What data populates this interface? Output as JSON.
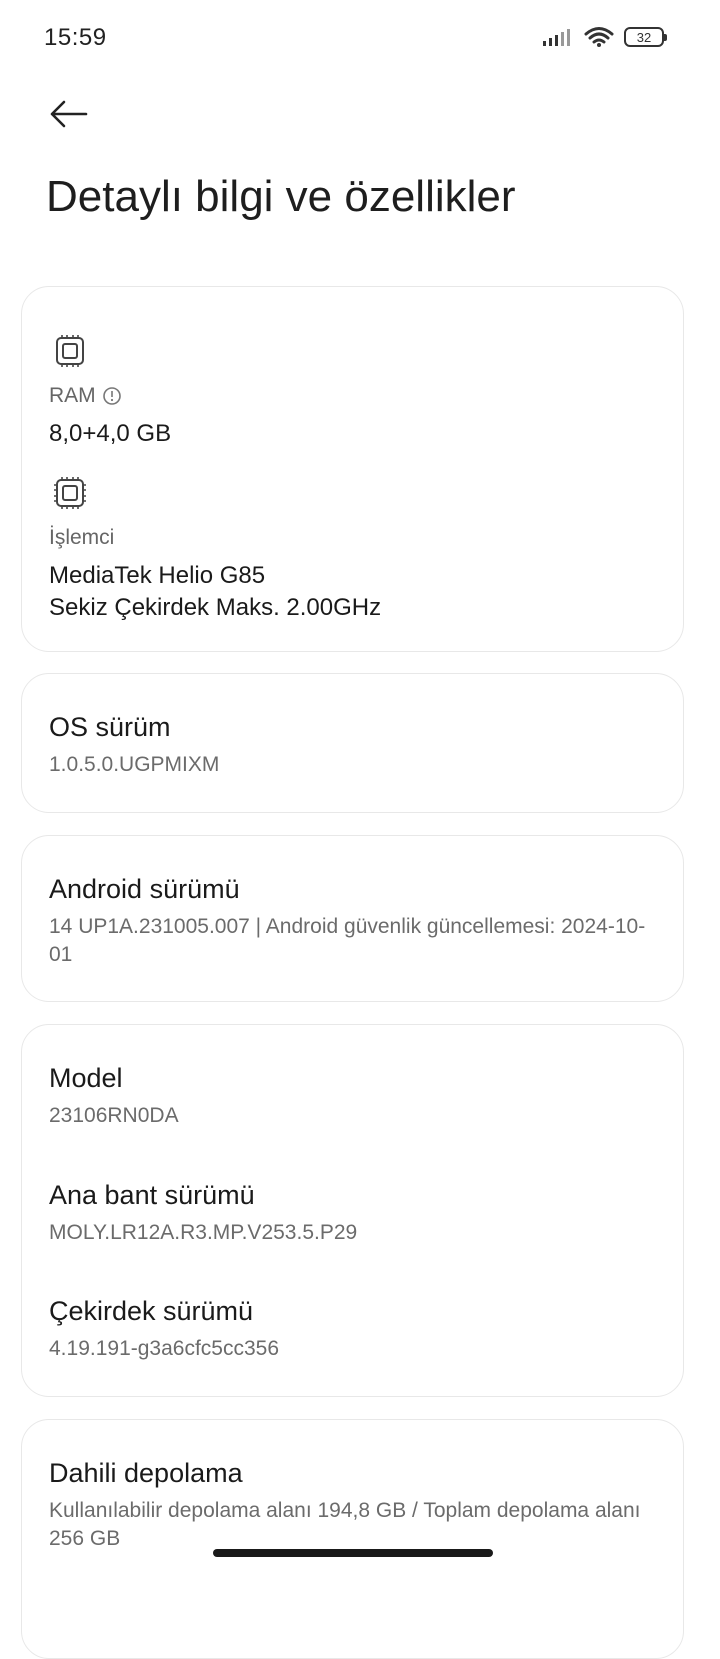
{
  "status_bar": {
    "time": "15:59",
    "battery": "32",
    "signal_icon": "signal-bars-icon",
    "wifi_icon": "wifi-icon"
  },
  "header": {
    "back_icon": "back-arrow-icon",
    "title": "Detaylı bilgi ve özellikler"
  },
  "hardware": {
    "ram_label": "RAM",
    "ram_value": "8,0+4,0 GB",
    "processor_label": "İşlemci",
    "processor_line1": "MediaTek Helio G85",
    "processor_line2": "Sekiz Çekirdek Maks. 2.00GHz"
  },
  "os": {
    "title": "OS sürüm",
    "value": "1.0.5.0.UGPMIXM"
  },
  "android": {
    "title": "Android sürümü",
    "value": "14 UP1A.231005.007 | Android güvenlik güncellemesi: 2024-10-01"
  },
  "device": {
    "model_title": "Model",
    "model_value": "23106RN0DA",
    "baseband_title": "Ana bant sürümü",
    "baseband_value": "MOLY.LR12A.R3.MP.V253.5.P29",
    "kernel_title": "Çekirdek sürümü",
    "kernel_value": "4.19.191-g3a6cfc5cc356"
  },
  "storage": {
    "title": "Dahili depolama",
    "value": "Kullanılabilir depolama alanı  194,8 GB / Toplam depolama alanı  256 GB"
  },
  "colors": {
    "background": "#ffffff",
    "card_border": "#e8e8e8",
    "text_primary": "#1a1a1a",
    "text_secondary": "#6b6b6b"
  }
}
